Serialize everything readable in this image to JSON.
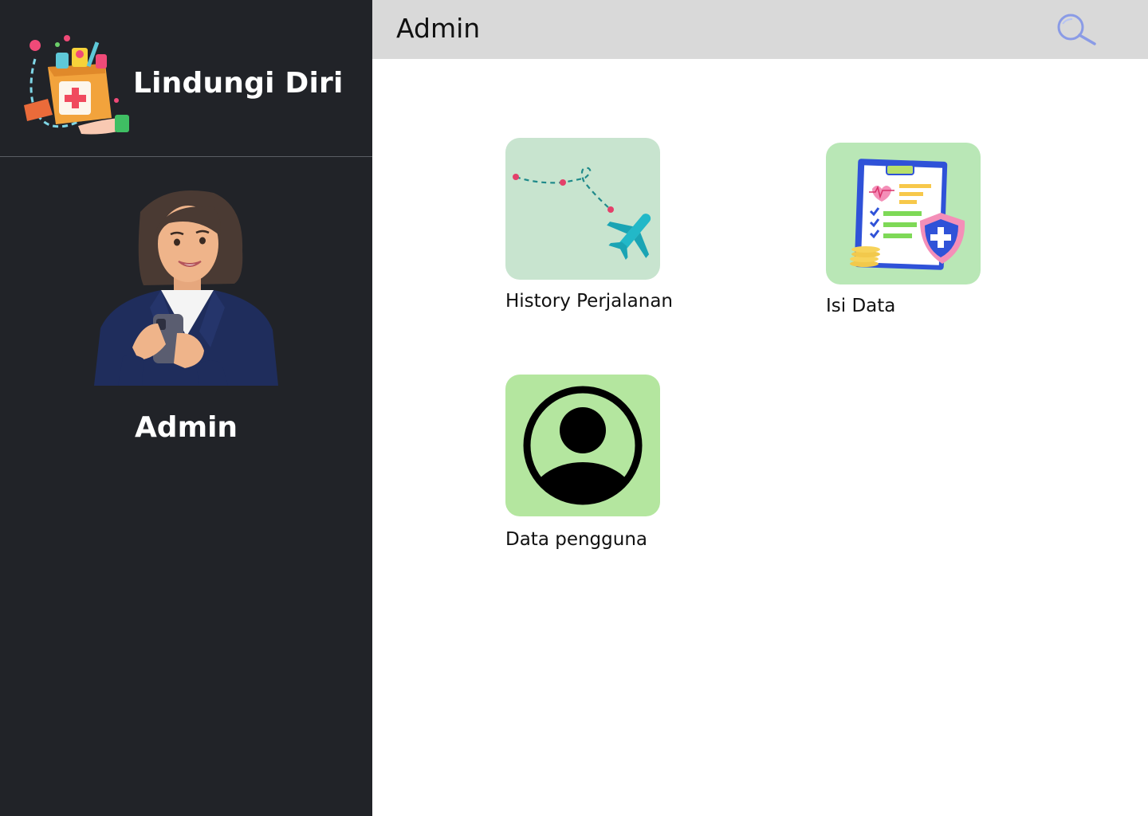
{
  "app": {
    "brand_title": "Lindungi Diri"
  },
  "user": {
    "role": "Admin"
  },
  "topbar": {
    "title": "Admin"
  },
  "menu": {
    "items": [
      {
        "label": "History Perjalanan",
        "icon": "travel-route-icon"
      },
      {
        "label": "Isi Data",
        "icon": "medical-clipboard-icon"
      },
      {
        "label": "Data pengguna",
        "icon": "user-profile-icon"
      }
    ]
  },
  "colors": {
    "sidebar_bg": "#212328",
    "topbar_bg": "#d9d9d9",
    "tile_history_bg": "#c8e4cf",
    "tile_isi_bg": "#b9e7b6",
    "tile_pengguna_bg": "#b4e69f",
    "search_icon": "#8a9be6"
  }
}
